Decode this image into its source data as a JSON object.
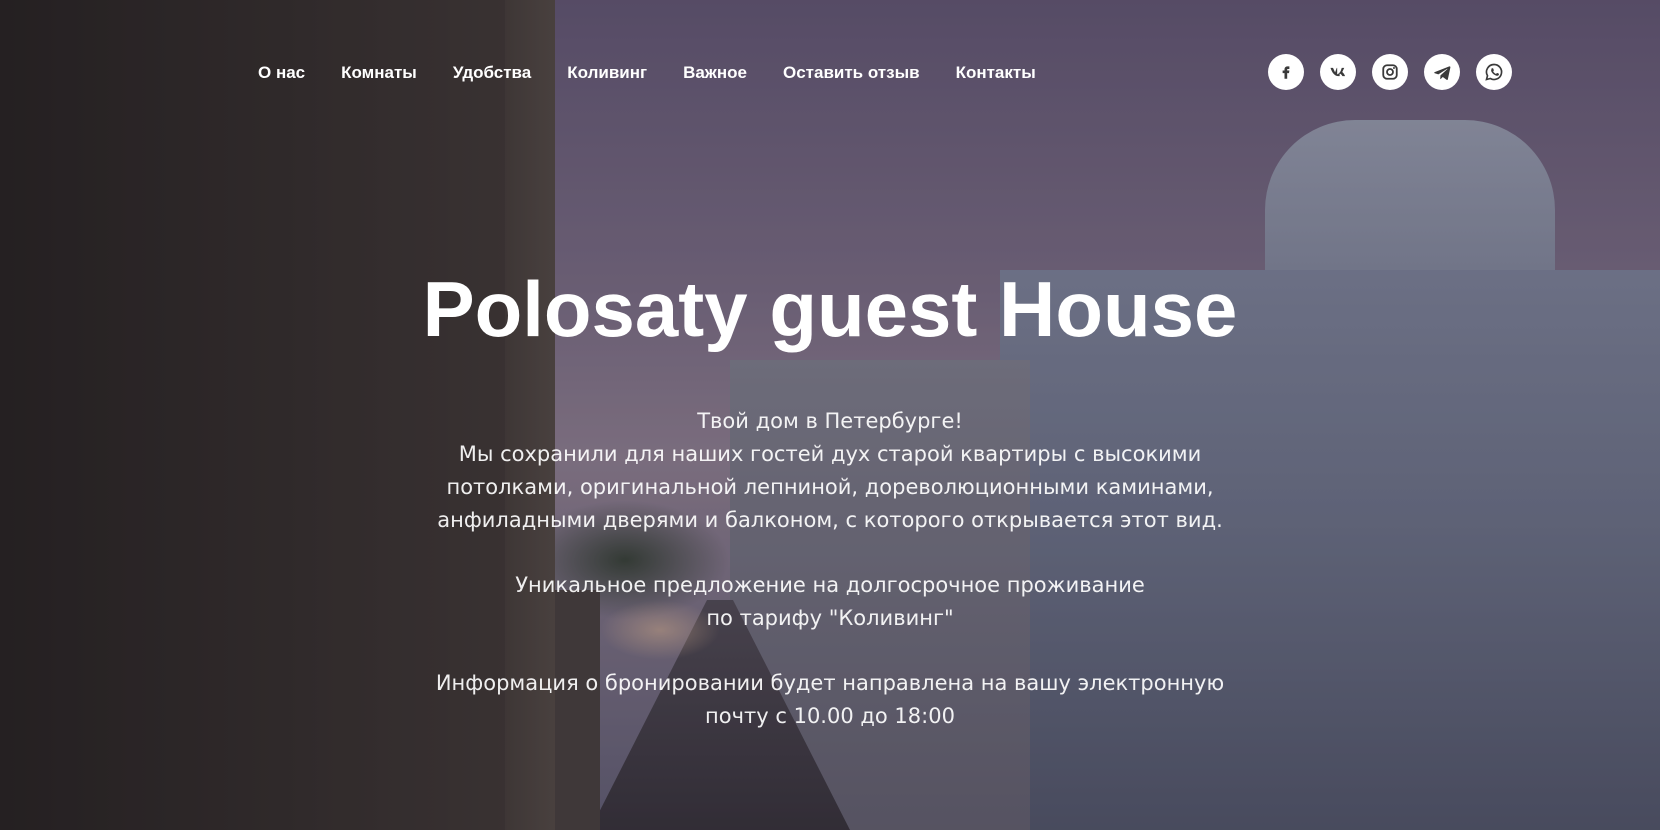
{
  "nav": {
    "items": [
      {
        "label": "О нас"
      },
      {
        "label": "Комнаты"
      },
      {
        "label": "Удобства"
      },
      {
        "label": "Коливинг"
      },
      {
        "label": "Важное"
      },
      {
        "label": "Оставить отзыв"
      },
      {
        "label": "Контакты"
      }
    ]
  },
  "social": [
    {
      "icon": "facebook-icon"
    },
    {
      "icon": "vk-icon"
    },
    {
      "icon": "instagram-icon"
    },
    {
      "icon": "telegram-icon"
    },
    {
      "icon": "whatsapp-icon"
    }
  ],
  "hero": {
    "title": "Polosaty guest House",
    "intro": [
      "Твой дом в Петербурге!",
      "Мы сохранили для наших гостей дух старой квартиры с высокими",
      "потолками, оригинальной лепниной, дореволюционными каминами,",
      "анфиладными дверями и балконом, с которого открывается этот вид."
    ],
    "offer": [
      "Уникальное предложение на долгосрочное проживание",
      "по тарифу \"Коливинг\""
    ],
    "info": [
      "Информация о бронировании будет направлена на вашу электронную",
      "почту с 10.00 до 18:00"
    ]
  },
  "colors": {
    "text": "#ffffff",
    "icon_fg": "#3a3a3a",
    "icon_bg": "#ffffff"
  }
}
